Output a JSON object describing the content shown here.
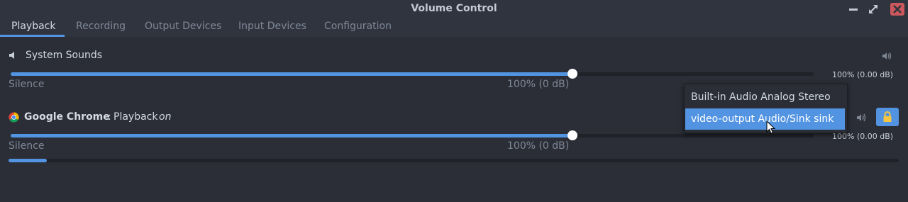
{
  "window": {
    "title": "Volume Control"
  },
  "tabs": [
    {
      "label": "Playback"
    },
    {
      "label": "Recording"
    },
    {
      "label": "Output Devices"
    },
    {
      "label": "Input Devices"
    },
    {
      "label": "Configuration"
    }
  ],
  "active_tab": "Playback",
  "streams": [
    {
      "name": "System Sounds",
      "icon": "speaker-icon",
      "mute_icon": "volume-icon",
      "volume_fraction": 0.7,
      "volume_text": "100% (0.00 dB)",
      "scale_min": "Silence",
      "scale_mark": "100% (0 dB)"
    },
    {
      "name": "Google Chrome",
      "separator": ":",
      "description": "Playback",
      "state": "on",
      "icon": "chrome-icon",
      "mute_icon": "volume-icon",
      "lock_icon": "lock-icon",
      "volume_fraction": 0.7,
      "volume_text": "100% (0.00 dB)",
      "scale_min": "Silence",
      "scale_mark": "100% (0 dB)",
      "level_meter_fraction": 0.043
    }
  ],
  "device_menu": {
    "options": [
      "Built-in Audio Analog Stereo",
      "video-output Audio/Sink sink"
    ],
    "selected": "video-output Audio/Sink sink"
  },
  "colors": {
    "accent": "#5294e2",
    "background": "#2b2e37",
    "close": "#cc575d"
  }
}
